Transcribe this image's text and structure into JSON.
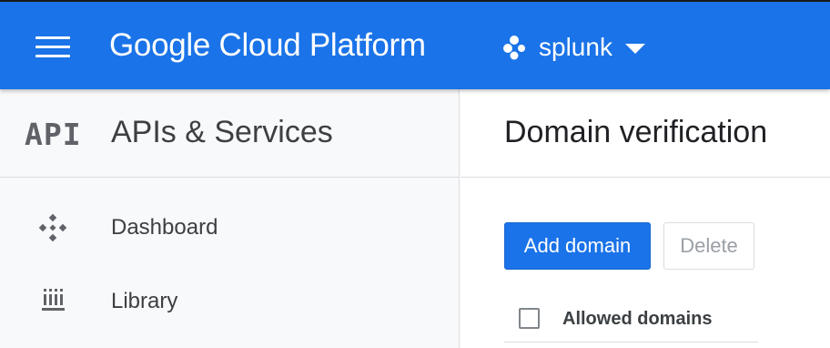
{
  "topbar": {
    "brand": "Google Cloud Platform",
    "project_name": "splunk",
    "menu_icon": "hamburger-menu-icon",
    "project_icon": "project-hexagon-icon",
    "project_dropdown_icon": "caret-down-icon",
    "color": "#1a73e8"
  },
  "sidebar": {
    "icon_text": "API",
    "title": "APIs & Services",
    "items": [
      {
        "label": "Dashboard",
        "icon": "dashboard-icon"
      },
      {
        "label": "Library",
        "icon": "library-icon"
      }
    ]
  },
  "main": {
    "title": "Domain verification",
    "add_button": "Add domain",
    "delete_button": "Delete",
    "table": {
      "columns": [
        "Allowed domains"
      ]
    }
  },
  "colors": {
    "accent": "#1a73e8",
    "sidebar_bg": "#f8f9fa",
    "divider": "#dadce0",
    "disabled_text": "#9aa0a6"
  }
}
